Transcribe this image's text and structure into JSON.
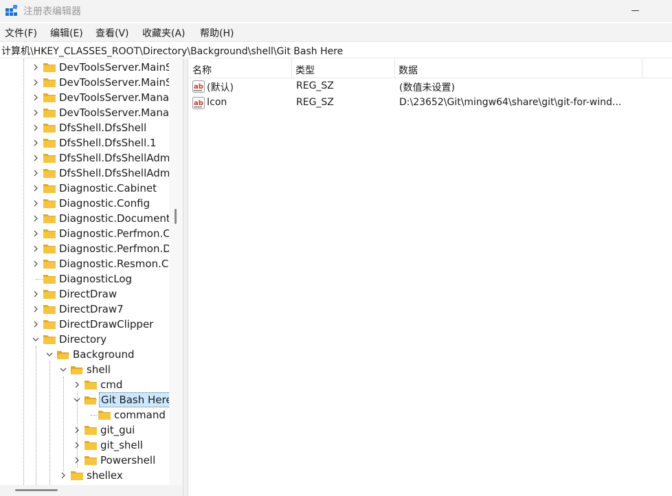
{
  "window": {
    "title": "注册表编辑器",
    "icons": {
      "app": "registry-editor-icon",
      "minimize": "minimize-icon"
    }
  },
  "menu": [
    {
      "label": "文件(F)",
      "name": "menu-file"
    },
    {
      "label": "编辑(E)",
      "name": "menu-edit"
    },
    {
      "label": "查看(V)",
      "name": "menu-view"
    },
    {
      "label": "收藏夹(A)",
      "name": "menu-favorites"
    },
    {
      "label": "帮助(H)",
      "name": "menu-help"
    }
  ],
  "address": {
    "path": "计算机\\HKEY_CLASSES_ROOT\\Directory\\Background\\shell\\Git Bash Here"
  },
  "tree": [
    {
      "label": "DevToolsServer.MainS",
      "level": 0,
      "chevron": "right"
    },
    {
      "label": "DevToolsServer.MainS",
      "level": 0,
      "chevron": "right"
    },
    {
      "label": "DevToolsServer.Mana",
      "level": 0,
      "chevron": "right"
    },
    {
      "label": "DevToolsServer.Mana",
      "level": 0,
      "chevron": "right"
    },
    {
      "label": "DfsShell.DfsShell",
      "level": 0,
      "chevron": "right"
    },
    {
      "label": "DfsShell.DfsShell.1",
      "level": 0,
      "chevron": "right"
    },
    {
      "label": "DfsShell.DfsShellAdmi",
      "level": 0,
      "chevron": "right"
    },
    {
      "label": "DfsShell.DfsShellAdmi",
      "level": 0,
      "chevron": "right"
    },
    {
      "label": "Diagnostic.Cabinet",
      "level": 0,
      "chevron": "right"
    },
    {
      "label": "Diagnostic.Config",
      "level": 0,
      "chevron": "right"
    },
    {
      "label": "Diagnostic.Document",
      "level": 0,
      "chevron": "right"
    },
    {
      "label": "Diagnostic.Perfmon.C",
      "level": 0,
      "chevron": "right"
    },
    {
      "label": "Diagnostic.Perfmon.D",
      "level": 0,
      "chevron": "right"
    },
    {
      "label": "Diagnostic.Resmon.Co",
      "level": 0,
      "chevron": "right"
    },
    {
      "label": "DiagnosticLog",
      "level": 0,
      "chevron": "none"
    },
    {
      "label": "DirectDraw",
      "level": 0,
      "chevron": "right"
    },
    {
      "label": "DirectDraw7",
      "level": 0,
      "chevron": "right"
    },
    {
      "label": "DirectDrawClipper",
      "level": 0,
      "chevron": "right"
    },
    {
      "label": "Directory",
      "level": 0,
      "chevron": "down"
    },
    {
      "label": "Background",
      "level": 1,
      "chevron": "down",
      "open": true
    },
    {
      "label": "shell",
      "level": 2,
      "chevron": "down",
      "open": true
    },
    {
      "label": "cmd",
      "level": 3,
      "chevron": "right"
    },
    {
      "label": "Git Bash Here",
      "level": 3,
      "chevron": "down",
      "open": true,
      "selected": true
    },
    {
      "label": "command",
      "level": 4,
      "chevron": "none"
    },
    {
      "label": "git_gui",
      "level": 3,
      "chevron": "right"
    },
    {
      "label": "git_shell",
      "level": 3,
      "chevron": "right"
    },
    {
      "label": "Powershell",
      "level": 3,
      "chevron": "right"
    },
    {
      "label": "shellex",
      "level": 2,
      "chevron": "right"
    }
  ],
  "list": {
    "columns": [
      "名称",
      "类型",
      "数据"
    ],
    "rows": [
      {
        "name": "(默认)",
        "type": "REG_SZ",
        "data": "(数值未设置)",
        "icon": "string-value-icon"
      },
      {
        "name": "Icon",
        "type": "REG_SZ",
        "data": "D:\\23652\\Git\\mingw64\\share\\git\\git-for-wind...",
        "icon": "string-value-icon"
      }
    ]
  },
  "colors": {
    "folder": "#f5c542",
    "folder_dark": "#e0a920",
    "selection": "#cce8ff",
    "icon_blue": "#1f6fd1",
    "ab_red": "#c0392b"
  }
}
